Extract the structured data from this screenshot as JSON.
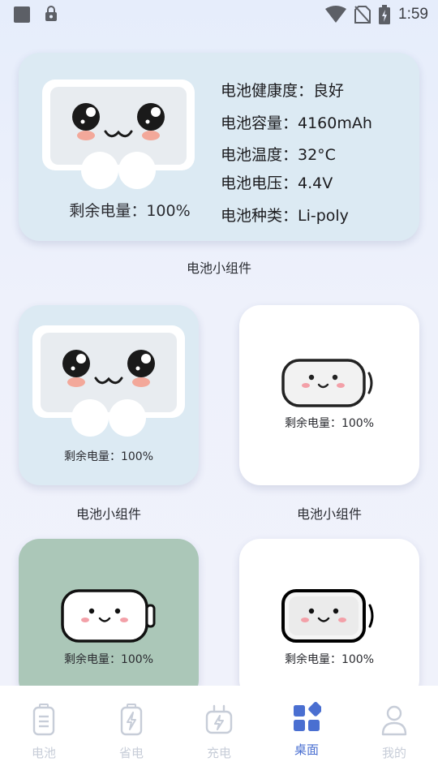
{
  "status_bar": {
    "time": "1:59",
    "left_icons": [
      "stop-square-icon",
      "lock-notification-icon"
    ],
    "right_icons": [
      "wifi-icon",
      "no-sim-icon",
      "battery-charging-icon"
    ]
  },
  "large_widget": {
    "remaining_label": "剩余电量：100%",
    "health": "电池健康度：良好",
    "capacity": "电池容量：4160mAh",
    "temperature": "电池温度：32°C",
    "voltage": "电池电压：4.4V",
    "type": "电池种类：Li-poly",
    "caption": "电池小组件"
  },
  "widgets": [
    {
      "remaining_label": "剩余电量：100%",
      "caption": "电池小组件",
      "style": "blue-face"
    },
    {
      "remaining_label": "剩余电量：100%",
      "caption": "电池小组件",
      "style": "white-battery"
    },
    {
      "remaining_label": "剩余电量：100%",
      "caption": "",
      "style": "green-battery"
    },
    {
      "remaining_label": "剩余电量：100%",
      "caption": "",
      "style": "white-battery-bold"
    }
  ],
  "tabs": [
    {
      "label": "电池",
      "icon": "battery-icon",
      "active": false
    },
    {
      "label": "省电",
      "icon": "power-save-icon",
      "active": false
    },
    {
      "label": "充电",
      "icon": "charging-icon",
      "active": false
    },
    {
      "label": "桌面",
      "icon": "widgets-icon",
      "active": true
    },
    {
      "label": "我的",
      "icon": "profile-icon",
      "active": false
    }
  ],
  "colors": {
    "accent": "#4a6fd1",
    "inactive_tab": "#c7cdd8",
    "blue_card": "#dceaf3",
    "green_card": "#abc7b8"
  }
}
